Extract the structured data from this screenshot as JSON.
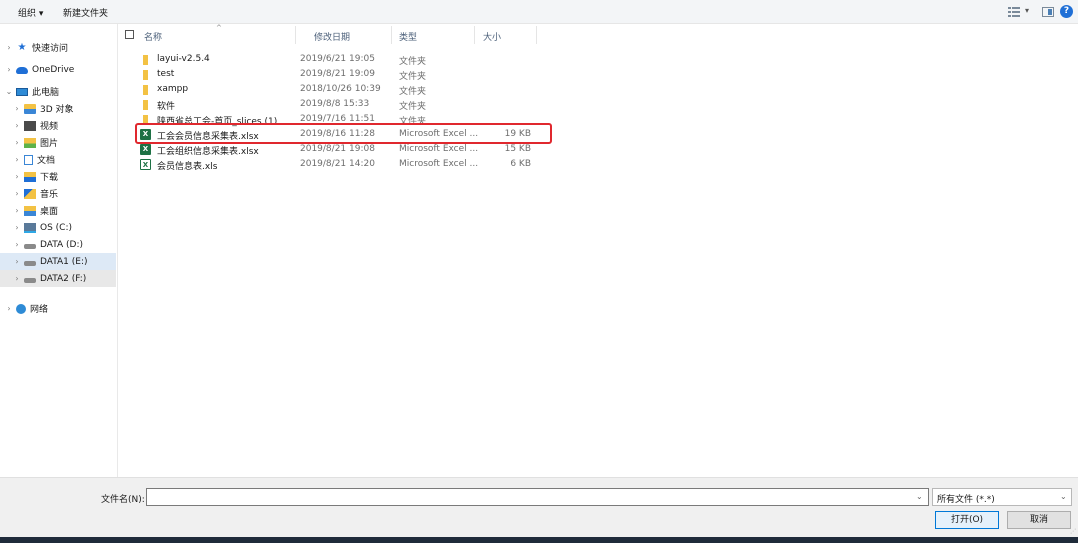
{
  "toolbar": {
    "organize_label": "组织 ▾",
    "new_folder_label": "新建文件夹",
    "view_caret": "▾",
    "help_label": "?"
  },
  "nav": {
    "items": [
      {
        "label": "快速访问",
        "chevron": "›",
        "icon": "star-icon"
      },
      {
        "label": "OneDrive",
        "chevron": "›",
        "icon": "cloud-icon"
      },
      {
        "label": "此电脑",
        "chevron": "⌄",
        "icon": "pc-icon"
      },
      {
        "label": "3D 对象",
        "chevron": "›",
        "icon": "folder-3d-icon"
      },
      {
        "label": "视频",
        "chevron": "›",
        "icon": "video-icon"
      },
      {
        "label": "图片",
        "chevron": "›",
        "icon": "pictures-icon"
      },
      {
        "label": "文档",
        "chevron": "›",
        "icon": "documents-icon"
      },
      {
        "label": "下载",
        "chevron": "›",
        "icon": "downloads-icon"
      },
      {
        "label": "音乐",
        "chevron": "›",
        "icon": "music-icon"
      },
      {
        "label": "桌面",
        "chevron": "›",
        "icon": "desktop-icon"
      },
      {
        "label": "OS (C:)",
        "chevron": "›",
        "icon": "os-drive-icon"
      },
      {
        "label": "DATA (D:)",
        "chevron": "›",
        "icon": "drive-icon"
      },
      {
        "label": "DATA1 (E:)",
        "chevron": "›",
        "icon": "drive-icon"
      },
      {
        "label": "DATA2 (F:)",
        "chevron": "›",
        "icon": "drive-icon"
      },
      {
        "label": "网络",
        "chevron": "›",
        "icon": "network-icon"
      }
    ]
  },
  "columns": {
    "name": "名称",
    "date": "修改日期",
    "type": "类型",
    "size": "大小",
    "sort_caret": "^"
  },
  "files": [
    {
      "name": "layui-v2.5.4",
      "date": "2019/6/21 19:05",
      "type": "文件夹",
      "size": "",
      "kind": "folder"
    },
    {
      "name": "test",
      "date": "2019/8/21 19:09",
      "type": "文件夹",
      "size": "",
      "kind": "folder"
    },
    {
      "name": "xampp",
      "date": "2018/10/26 10:39",
      "type": "文件夹",
      "size": "",
      "kind": "folder"
    },
    {
      "name": "软件",
      "date": "2019/8/8 15:33",
      "type": "文件夹",
      "size": "",
      "kind": "folder"
    },
    {
      "name": "陕西省总工会-首页_slices (1)",
      "date": "2019/7/16 11:51",
      "type": "文件夹",
      "size": "",
      "kind": "folder"
    },
    {
      "name": "工会会员信息采集表.xlsx",
      "date": "2019/8/16 11:28",
      "type": "Microsoft Excel ...",
      "size": "19 KB",
      "kind": "xlsx"
    },
    {
      "name": "工会组织信息采集表.xlsx",
      "date": "2019/8/21 19:08",
      "type": "Microsoft Excel ...",
      "size": "15 KB",
      "kind": "xlsx"
    },
    {
      "name": "会员信息表.xls",
      "date": "2019/8/21 14:20",
      "type": "Microsoft Excel ...",
      "size": "6 KB",
      "kind": "xls"
    }
  ],
  "bottom": {
    "filename_label": "文件名(N):",
    "filename_value": "",
    "filetype_value": "所有文件 (*.*)",
    "dropdown_caret": "⌄",
    "open_label": "打开(O)",
    "cancel_label": "取消"
  },
  "colors": {
    "highlight": "#e0282e",
    "selected_nav": "#dde9f6",
    "accent": "#0078d7"
  }
}
